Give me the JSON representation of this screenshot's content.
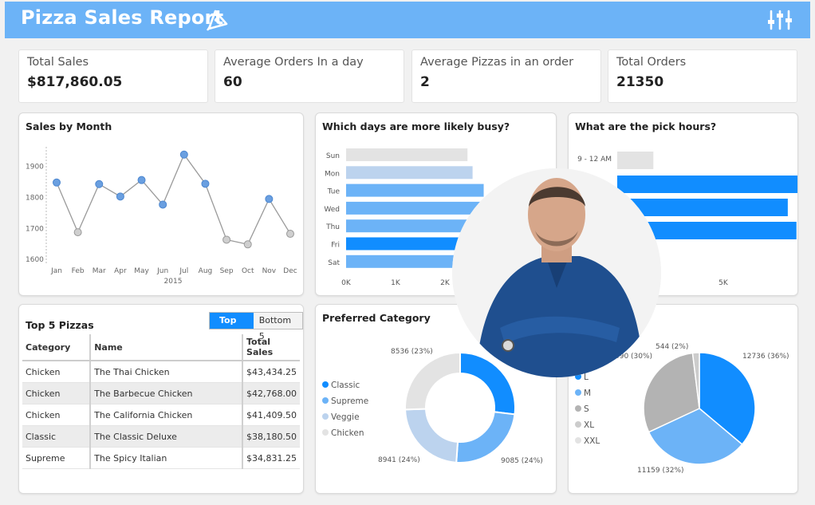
{
  "header": {
    "title": "Pizza Sales Report",
    "logo_icon": "pizza-rocket-icon",
    "filter_icon": "sliders-icon"
  },
  "kpis": [
    {
      "label": "Total Sales",
      "value": "$817,860.05"
    },
    {
      "label": "Average Orders In a day",
      "value": "60"
    },
    {
      "label": "Average Pizzas in an order",
      "value": "2"
    },
    {
      "label": "Total Orders",
      "value": "21350"
    }
  ],
  "colors": {
    "accent": "#118dff",
    "light_blue": "#6cb3f7",
    "pale_blue": "#bcd3ee",
    "grey": "#e3e3e3"
  },
  "sales_by_month": {
    "title": "Sales by Month"
  },
  "busy_days": {
    "title": "Which days are more likely busy?"
  },
  "pick_hours": {
    "title": "What are the pick hours?"
  },
  "top_pizzas": {
    "title": "Top 5 Pizzas",
    "toggle_on": "Top 5",
    "toggle_off": "Bottom 5",
    "columns": [
      "Category",
      "Name",
      "Total Sales"
    ],
    "rows": [
      [
        "Chicken",
        "The Thai Chicken",
        "$43,434.25"
      ],
      [
        "Chicken",
        "The Barbecue Chicken",
        "$42,768.00"
      ],
      [
        "Chicken",
        "The California Chicken",
        "$41,409.50"
      ],
      [
        "Classic",
        "The Classic Deluxe",
        "$38,180.50"
      ],
      [
        "Supreme",
        "The Spicy Italian",
        "$34,831.25"
      ]
    ]
  },
  "preferred_category": {
    "title": "Preferred Category"
  },
  "chart_data": [
    {
      "type": "line",
      "title": "Sales by Month",
      "x": [
        "Jan",
        "Feb",
        "Mar",
        "Apr",
        "May",
        "Jun",
        "Jul",
        "Aug",
        "Sep",
        "Oct",
        "Nov",
        "Dec"
      ],
      "y": [
        1845,
        1685,
        1840,
        1800,
        1853,
        1774,
        1935,
        1841,
        1661,
        1646,
        1792,
        1680
      ],
      "xlabel": "2015",
      "yticks": [
        1600,
        1700,
        1800,
        1900
      ],
      "ylim": [
        1580,
        1960
      ]
    },
    {
      "type": "bar",
      "title": "Which days are more likely busy?",
      "orientation": "horizontal",
      "categories": [
        "Sun",
        "Mon",
        "Tue",
        "Wed",
        "Thu",
        "Fri",
        "Sat"
      ],
      "values": [
        2620,
        2730,
        2970,
        2900,
        3020,
        3530,
        3160
      ],
      "colors": [
        "#e3e3e3",
        "#bcd3ee",
        "#6cb3f7",
        "#6cb3f7",
        "#6cb3f7",
        "#118dff",
        "#6cb3f7"
      ],
      "xticks": [
        "0K",
        "1K",
        "2K"
      ],
      "xlim": [
        0,
        4200
      ]
    },
    {
      "type": "bar",
      "title": "What are the pick hours?",
      "orientation": "horizontal",
      "categories": [
        "9 - 12 AM"
      ],
      "values": [
        1250,
        6800,
        5900,
        6200
      ],
      "colors": [
        "#e3e3e3",
        "#118dff",
        "#118dff",
        "#118dff"
      ],
      "xticks": [
        "5K"
      ],
      "xlim": [
        0,
        8000
      ]
    },
    {
      "type": "pie",
      "title": "Preferred Category",
      "donut": true,
      "legend": [
        "Classic",
        "Supreme",
        "Veggie",
        "Chicken"
      ],
      "values": [
        9085,
        8941,
        8536
      ],
      "labels": [
        "9085 (24%)",
        "8941 (24%)",
        "8536 (23%)"
      ],
      "colors": [
        "#118dff",
        "#6cb3f7",
        "#bcd3ee",
        "#e3e3e3"
      ]
    },
    {
      "type": "pie",
      "legend": [
        "L",
        "M",
        "S",
        "XL",
        "XXL"
      ],
      "values": [
        12736,
        11159,
        490,
        544
      ],
      "labels": [
        "12736 (36%)",
        "11159 (32%)",
        "490 (30%)",
        "544 (2%)"
      ],
      "colors": [
        "#118dff",
        "#6cb3f7",
        "#b3b3b3",
        "#cccccc",
        "#e3e3e3"
      ]
    }
  ]
}
